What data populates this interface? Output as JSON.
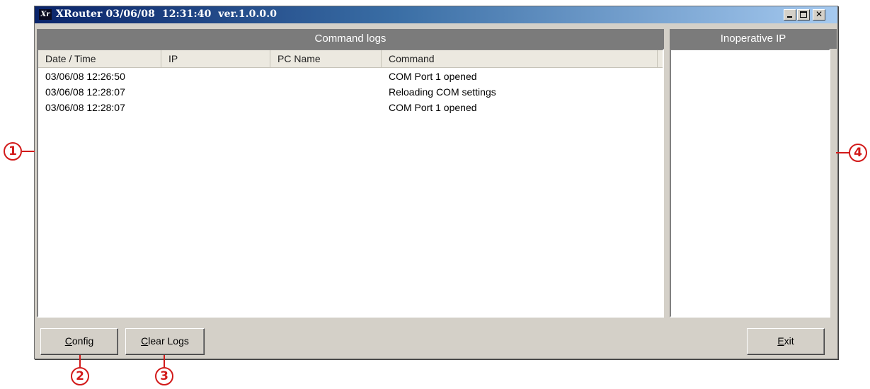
{
  "window": {
    "app_icon_text": "Xr",
    "title": "XRouter 03/06/08  12:31:40  ver.1.0.0.0",
    "minimize_glyph": "",
    "maximize_glyph": "",
    "close_glyph": "✕"
  },
  "logs": {
    "header": "Command logs",
    "columns": [
      "Date / Time",
      "IP",
      "PC Name",
      "Command"
    ],
    "rows": [
      {
        "datetime": "03/06/08 12:26:50",
        "ip": "",
        "pc_name": "",
        "command": "COM Port 1 opened"
      },
      {
        "datetime": "03/06/08 12:28:07",
        "ip": "",
        "pc_name": "",
        "command": "Reloading COM settings"
      },
      {
        "datetime": "03/06/08 12:28:07",
        "ip": "",
        "pc_name": "",
        "command": "COM Port 1 opened"
      }
    ]
  },
  "inoperative": {
    "header": "Inoperative IP"
  },
  "buttons": {
    "config": {
      "mnemonic": "C",
      "rest": "onfig"
    },
    "clear_logs": {
      "mnemonic": "C",
      "rest": "lear Logs"
    },
    "exit": {
      "mnemonic": "E",
      "rest": "xit"
    }
  },
  "callouts": [
    "1",
    "2",
    "3",
    "4"
  ],
  "colors": {
    "callout": "#d21a1a",
    "section_header_bg": "#7b7b7b",
    "window_bg": "#d4d0c8"
  }
}
